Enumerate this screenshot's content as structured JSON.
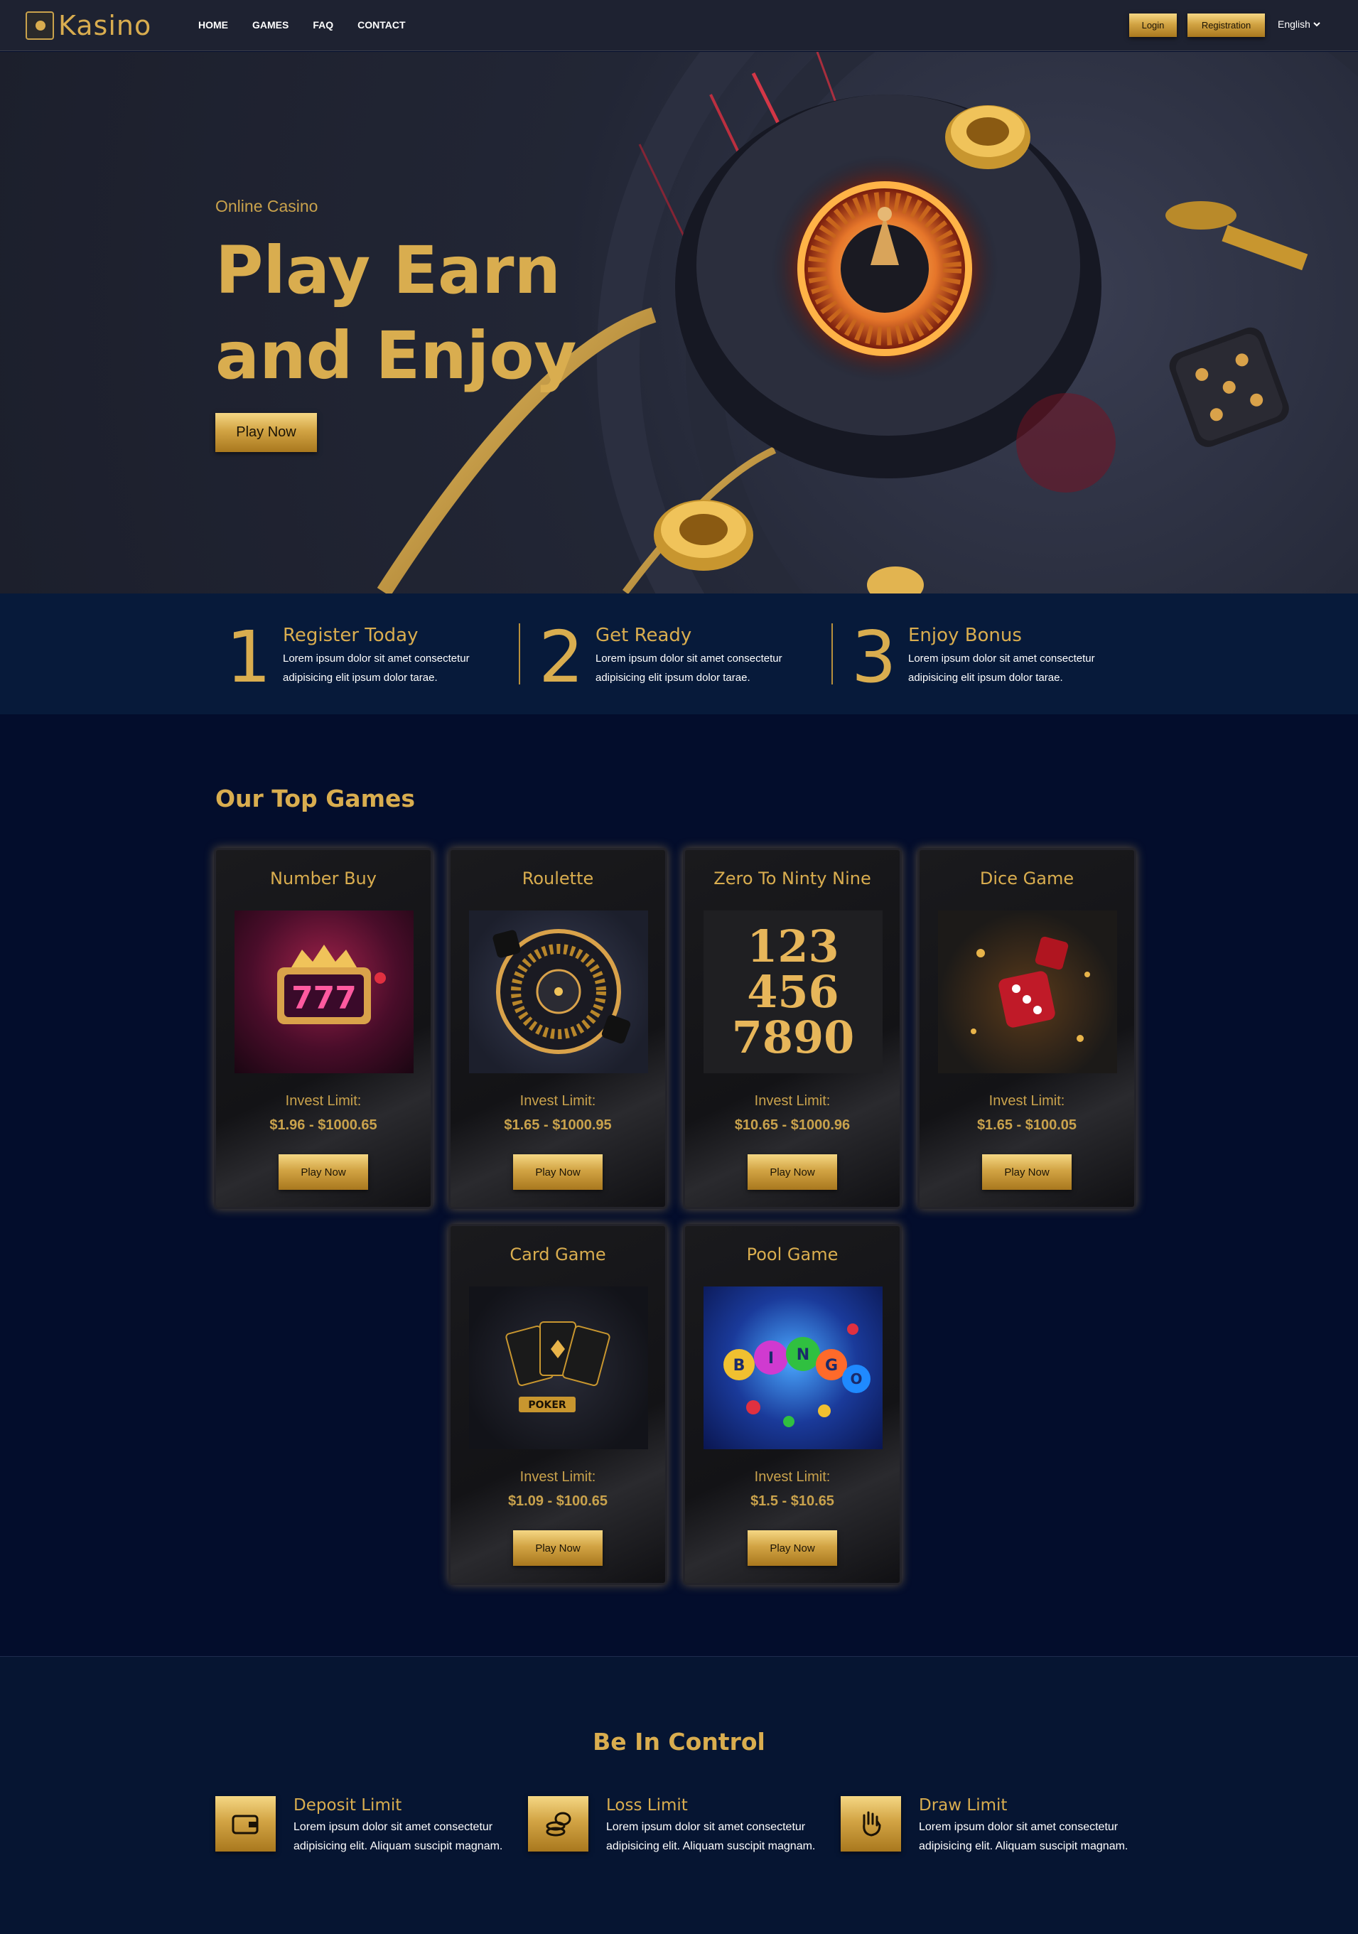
{
  "nav": {
    "logo": "Kasino",
    "menu": [
      "HOME",
      "GAMES",
      "FAQ",
      "CONTACT"
    ],
    "login": "Login",
    "registration": "Registration",
    "language": "English"
  },
  "hero": {
    "subtitle": "Online Casino",
    "title_line1": "Play Earn",
    "title_line2": "and Enjoy",
    "button": "Play Now"
  },
  "steps": [
    {
      "num": "1",
      "title": "Register Today",
      "desc": "Lorem ipsum dolor sit amet consectetur adipisicing elit ipsum dolor tarae."
    },
    {
      "num": "2",
      "title": "Get Ready",
      "desc": "Lorem ipsum dolor sit amet consectetur adipisicing elit ipsum dolor tarae."
    },
    {
      "num": "3",
      "title": "Enjoy Bonus",
      "desc": "Lorem ipsum dolor sit amet consectetur adipisicing elit ipsum dolor tarae."
    }
  ],
  "games": {
    "title": "Our Top Games",
    "invest_label": "Invest Limit:",
    "button": "Play Now",
    "items": [
      {
        "title": "Number Buy",
        "limit": "$1.96 - $1000.65"
      },
      {
        "title": "Roulette",
        "limit": "$1.65 - $1000.95"
      },
      {
        "title": "Zero To Ninty Nine",
        "limit": "$10.65 - $1000.96"
      },
      {
        "title": "Dice Game",
        "limit": "$1.65 - $100.05"
      },
      {
        "title": "Card Game",
        "limit": "$1.09 - $100.65"
      },
      {
        "title": "Pool Game",
        "limit": "$1.5 - $10.65"
      }
    ],
    "slot_text": "777",
    "numbers_text": [
      "123",
      "456",
      "7890"
    ],
    "poker_text": "POKER",
    "bingo_text": [
      "B",
      "I",
      "N",
      "G",
      "O"
    ]
  },
  "control": {
    "title": "Be In Control",
    "items": [
      {
        "title": "Deposit Limit",
        "desc": "Lorem ipsum dolor sit amet consectetur adipisicing elit. Aliquam suscipit magnam.",
        "icon": "wallet-icon"
      },
      {
        "title": "Loss Limit",
        "desc": "Lorem ipsum dolor sit amet consectetur adipisicing elit. Aliquam suscipit magnam.",
        "icon": "coins-icon"
      },
      {
        "title": "Draw Limit",
        "desc": "Lorem ipsum dolor sit amet consectetur adipisicing elit. Aliquam suscipit magnam.",
        "icon": "hand-icon"
      }
    ]
  },
  "colors": {
    "gold": "#d9ad4f",
    "navy": "#030d2c",
    "panel": "#071a3a",
    "dark": "#1e2231"
  }
}
